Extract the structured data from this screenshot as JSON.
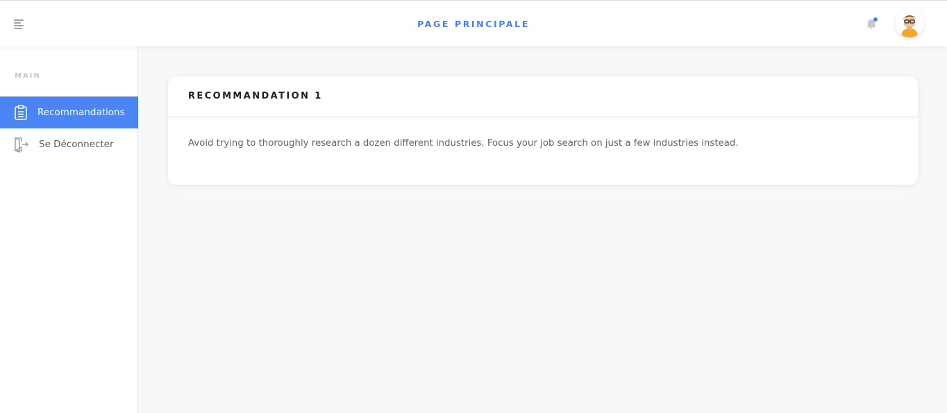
{
  "header": {
    "title": "PAGE PRINCIPALE",
    "menu_icon": "hamburger-menu-icon",
    "bell_icon": "bell-icon",
    "accent_color": "#4a7cf3"
  },
  "sidebar": {
    "section_heading": "MAIN",
    "items": [
      {
        "label": "Recommandations",
        "icon": "clipboard-icon",
        "active": true
      },
      {
        "label": "Se Déconnecter",
        "icon": "logout-door-icon",
        "active": false
      }
    ],
    "active_color": "#4a84f5"
  },
  "card": {
    "title": "RECOMMANDATION 1",
    "body": "Avoid trying to thoroughly research a dozen different industries. Focus your job search on just a few industries instead."
  }
}
